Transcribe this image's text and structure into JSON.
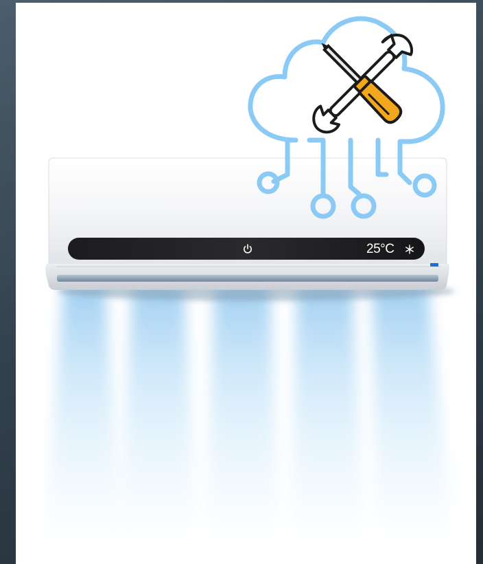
{
  "ac_unit": {
    "display": {
      "temperature": "25",
      "unit": "°C",
      "power_icon": "power-icon",
      "mode_icon": "snowflake-icon"
    },
    "body_color": "#f4f5f7",
    "display_color": "#1d1d1f",
    "indicator_color": "#1e6fd0"
  },
  "cloud_overlay": {
    "icon": "cloud-circuit-icon",
    "tools_icon": "wrench-screwdriver-icon",
    "outline_color": "#8ccaf6",
    "tool_handle_color": "#f2a71c"
  },
  "airflow": {
    "color": "#a9d8f6"
  }
}
